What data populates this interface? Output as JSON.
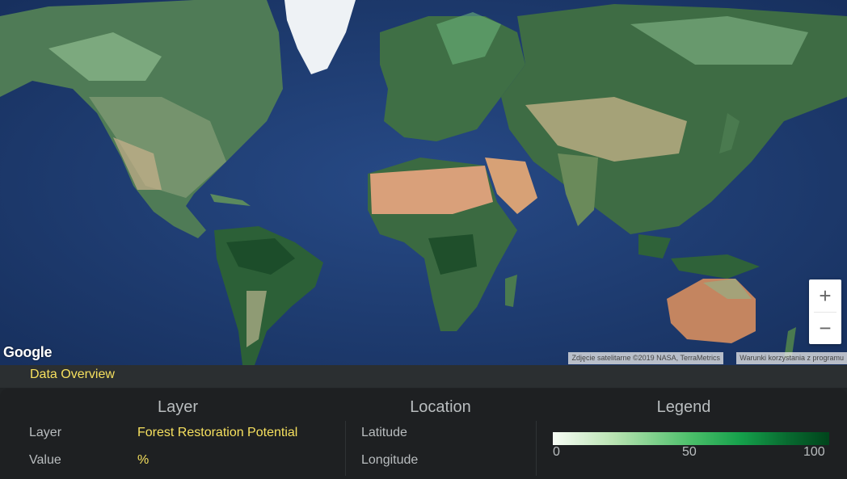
{
  "map": {
    "provider_logo": "Google",
    "attribution": "Zdjęcie satelitarne ©2019 NASA, TerraMetrics",
    "terms_link": "Warunki korzystania z programu",
    "zoom_in_label": "+",
    "zoom_out_label": "−"
  },
  "overview": {
    "title": "Data Overview"
  },
  "panel": {
    "layer": {
      "heading": "Layer",
      "layer_label": "Layer",
      "layer_value": "Forest Restoration Potential",
      "value_label": "Value",
      "value_value": "%"
    },
    "location": {
      "heading": "Location",
      "latitude_label": "Latitude",
      "longitude_label": "Longitude"
    },
    "legend": {
      "heading": "Legend",
      "ticks": [
        "0",
        "50",
        "100"
      ],
      "colors": [
        "#f7fcf5",
        "#b9e3b2",
        "#4bbf6a",
        "#15a04b",
        "#086a30",
        "#00441b"
      ]
    }
  },
  "colors": {
    "accent": "#f6e05e",
    "ocean": "#1e3a6e",
    "panel_bg": "#1e2022"
  }
}
